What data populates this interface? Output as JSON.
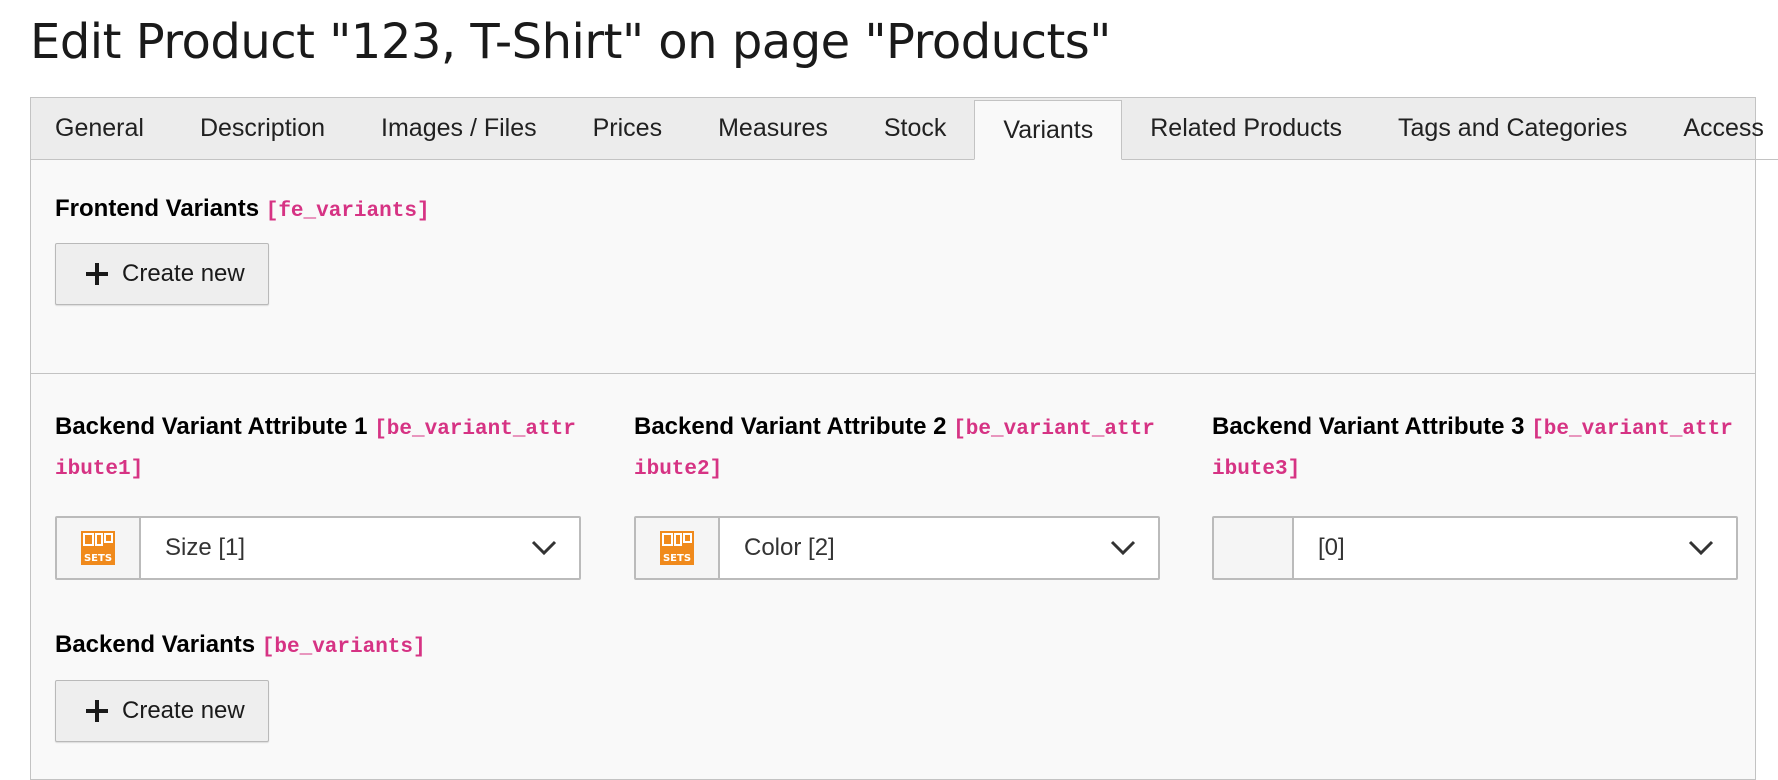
{
  "page": {
    "title": "Edit Product \"123, T-Shirt\" on page \"Products\""
  },
  "tabs": [
    {
      "label": "General"
    },
    {
      "label": "Description"
    },
    {
      "label": "Images / Files"
    },
    {
      "label": "Prices"
    },
    {
      "label": "Measures"
    },
    {
      "label": "Stock"
    },
    {
      "label": "Variants",
      "active": true
    },
    {
      "label": "Related Products"
    },
    {
      "label": "Tags and Categories"
    },
    {
      "label": "Access"
    }
  ],
  "frontend_variants": {
    "label": "Frontend Variants",
    "field": "[fe_variants]",
    "button_label": "Create new"
  },
  "attributes": [
    {
      "label": "Backend Variant Attribute 1",
      "field_line1": "[be_variant_attr",
      "field_line2": "ibute1]",
      "value": "Size [1]",
      "icon": "sets-icon"
    },
    {
      "label": "Backend Variant Attribute 2",
      "field_line1": "[be_variant_attr",
      "field_line2": "ibute2]",
      "value": "Color [2]",
      "icon": "sets-icon"
    },
    {
      "label": "Backend Variant Attribute 3",
      "field_line1": "[be_variant_attr",
      "field_line2": "ibute3]",
      "value": "[0]",
      "icon": ""
    }
  ],
  "backend_variants": {
    "label": "Backend Variants",
    "field": "[be_variants]",
    "button_label": "Create new"
  },
  "colors": {
    "accent_code": "#d63384",
    "sets_icon": "#f08a1c"
  }
}
